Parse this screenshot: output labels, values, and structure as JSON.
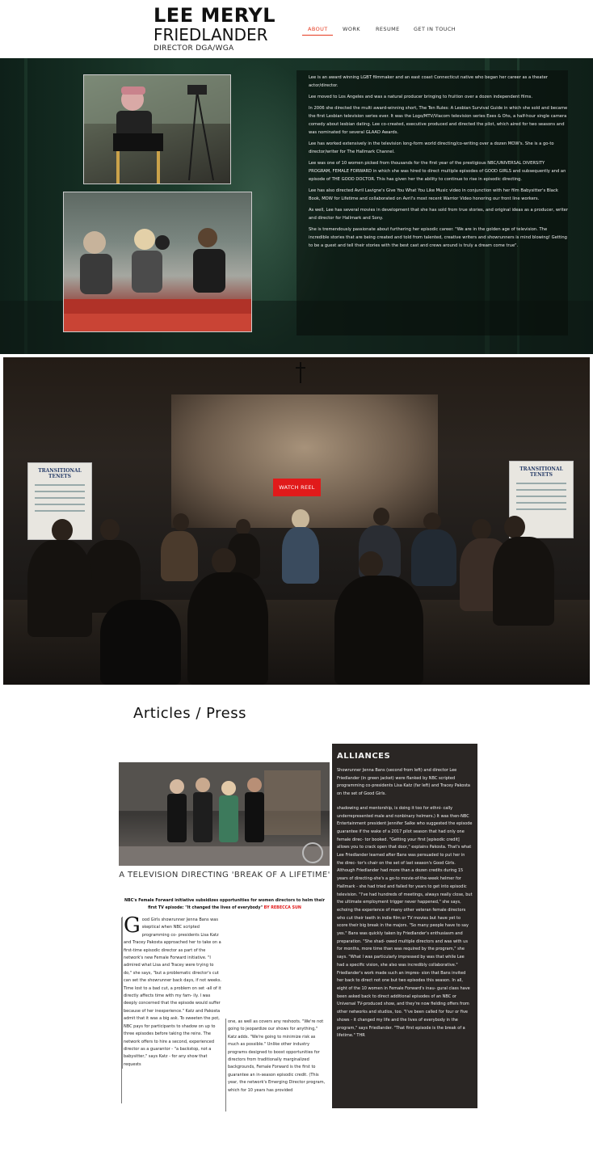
{
  "header": {
    "logo_line1": "LEE MERYL",
    "logo_line2": "FRIEDLANDER",
    "logo_line3": "DIRECTOR DGA/WGA",
    "nav": [
      "ABOUT",
      "WORK",
      "RESUME",
      "GET IN TOUCH"
    ],
    "accent_color": "#e5391f"
  },
  "about": {
    "paragraphs": [
      "Lee is an award winning LGBT filmmaker and an east coast Connecticut native who began her career as a theater actor/director.",
      "Lee moved to Los Angeles and was a natural producer bringing to fruition over a dozen independent films.",
      "In 2006 she directed the multi award-winning short, The Ten Rules: A Lesbian Survival Guide in which she sold and became the first Lesbian television series ever. It was the Logo/MTV/Viacom television series Exes & Ohs, a half-hour single camera comedy about lesbian dating. Lee co-created, executive produced and directed the pilot, which aired for two seasons and was nominated for several GLAAD Awards.",
      "Lee has worked extensively in the television long-form world directing/co-writing over a dozen MOW's. She is a go-to director/writer for The Hallmark Channel.",
      "Lee was one of 10 women picked from thousands for the first year of the prestigious NBC/UNIVERSAL DIVERSITY PROGRAM, FEMALE FORWARD in which she was hired to direct multiple episodes of GOOD GIRLS and subsequently and an episode of THE GOOD DOCTOR. This has given her the ability to continue to rise in episodic directing.",
      "Lee has also directed Avril Lavigne's Give You What You Like Music video in conjunction with her film Babysitter's Black Book, MOW for Lifetime and collaborated on Avril's most recent Warrior Video honoring our front line workers.",
      "As well, Lee has several movies in development that she has sold from true stories, and original ideas as a producer, writer and director for Hallmark and Sony.",
      "She is tremendously passionate about furthering her episodic career. \"We are in the golden age of television. The incredible stories that are being created and told from talented, creative writers and showrunners is mind blowing! Getting to be a guest and tell their stories with the best cast and crews around is truly a dream come true\"."
    ]
  },
  "hero": {
    "button_label": "WATCH REEL",
    "board_title": "TRANSITIONAL TENETS",
    "button_color": "#e11a1a"
  },
  "articles": {
    "section_title": "Articles / Press",
    "headline": "A TELEVISION DIRECTING 'BREAK OF A LIFETIME'",
    "dek": "NBC's Female Forward initiative subsidizes opportunities for women directors to helm their first TV episode: \"It changed the lives of everybody\"",
    "byline": "BY REBECCA SUN",
    "dropcap": "G",
    "col1": "ood Girls showrunner Jenna Bans was skeptical when NBC scripted programming co- presidents Lisa Katz and Tracey Pakosta approached her to take on a first-time episodic director as part of the network's new Female Forward initiative. \"I admired what Lisa and Tracey were trying to do,\" she says, \"but a problematic director's cut can set the showrunner back days, if not weeks. Time lost to a bad cut, a problem on set -all of it directly affects time with my fam- ily. I was deeply concerned that the episode would suffer because of her inexperience.\" Katz and Pakosta admit that it was a big ask. To sweeten the pot, NBC pays for participants to shadow on up to three episodes before taking the reins. The network offers to hire a second, experienced director as a guarantor - \"a backstop, not a babysitter,\" says Katz - for any show that requests",
    "col2": "one, as well as covers any reshoots. \"We're not going to jeopardize our shows for anything,\" Katz adds. \"We're going to minimize risk as much as possible.\" Unlike other industry programs designed to boost opportunities for directors from traditionally marginalized backgrounds, Female Forward is the first to guarantee an in-season episodic credit. (This year, the network's Emerging Director program, which for 10 years has provided",
    "sidebar_title": "ALLIANCES",
    "sidebar_caption": "Showrunner Jenna Bans (second from left) and director Lee Friedlander (in green jacket) were flanked by NBC scripted programming co-presidents Lisa Katz (far left) and Tracey Pakosta on the set of Good Girls.",
    "sidebar_body": "shadowing and mentorship, is doing it too for ethni- cally underrepresented male and nonbinary helmers.) It was then-NBC Entertainment president Jennifer Salke who suggested the episode guarantee if the wake of a 2017 pilot season that had only one female direc- tor booked. \"Getting your first [episodic credit] allows you to crack open that door,\" explains Pakosta. That's what Lee Friedlander learned after Bans was persuaded to put her in the direc- tor's chair on the set of last season's Good Girls. Although Friedlander had more than a dozen credits during 15 years of directing-she's a go-to movie-of-the-week helmer for Hallmark - she had tried and failed for years to get into episodic television. \"I've had hundreds of meetings, always really close, but the ultimate employment trigger never happened,\" she says, echoing the experience of many other veteran female directors who cut their teeth in indie film or TV movies but have yet to score their big break in the majors. \"So many people have to say yes.\" Bans was quickly taken by Friedlander's enthusiasm and preparation. \"She shad- owed multiple directors and was with us for months, more time than was required by the program,\" she says. \"What I was particularly impressed by was that while Lee had a specific vision, she also was incredibly collaborative.\" Friedlander's work made such an impres- sion that Bans invited her back to direct not one but two episodes this season. In all, eight of the 10 women in Female Forward's inau- gural class have been asked back to direct additional episodes of an NBC or Universal TV-produced show, and they're now fielding offers from other networks and studios, too. \"I've been called for four or five shows - it changed my life and the lives of everybody in the program,\" says Friedlander. \"That first episode is the break of a lifetime.\" THR"
  }
}
